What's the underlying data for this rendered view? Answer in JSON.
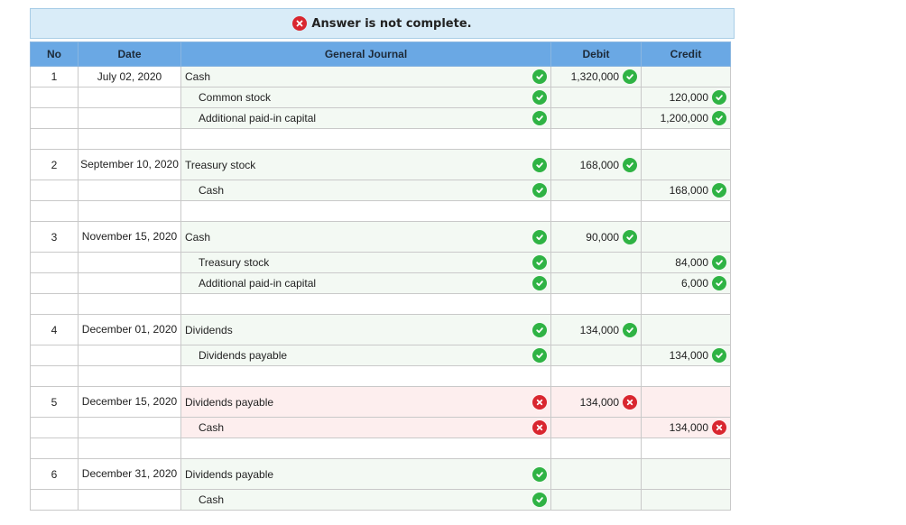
{
  "banner": {
    "status_icon": "cross-circle-icon",
    "text": "Answer is not complete."
  },
  "headers": {
    "no": "No",
    "date": "Date",
    "journal": "General Journal",
    "debit": "Debit",
    "credit": "Credit"
  },
  "colors": {
    "header_bg": "#6aa8e4",
    "correct": "#2fb344",
    "incorrect": "#d9262f",
    "banner_bg": "#d9ecf8"
  },
  "rows": [
    {
      "no": "1",
      "date": "July 02, 2020",
      "account": "Cash",
      "indent": false,
      "acct_status": "correct",
      "debit": "1,320,000",
      "debit_status": "correct",
      "credit": "",
      "credit_status": ""
    },
    {
      "no": "",
      "date": "",
      "account": "Common stock",
      "indent": true,
      "acct_status": "correct",
      "debit": "",
      "debit_status": "",
      "credit": "120,000",
      "credit_status": "correct"
    },
    {
      "no": "",
      "date": "",
      "account": "Additional paid-in capital",
      "indent": true,
      "acct_status": "correct",
      "debit": "",
      "debit_status": "",
      "credit": "1,200,000",
      "credit_status": "correct"
    },
    {
      "no": "",
      "date": "",
      "account": "",
      "indent": false,
      "acct_status": "",
      "debit": "",
      "debit_status": "",
      "credit": "",
      "credit_status": "",
      "blank": true
    },
    {
      "no": "2",
      "date": "September 10, 2020",
      "account": "Treasury stock",
      "indent": false,
      "acct_status": "correct",
      "debit": "168,000",
      "debit_status": "correct",
      "credit": "",
      "credit_status": "",
      "tall": true
    },
    {
      "no": "",
      "date": "",
      "account": "Cash",
      "indent": true,
      "acct_status": "correct",
      "debit": "",
      "debit_status": "",
      "credit": "168,000",
      "credit_status": "correct"
    },
    {
      "no": "",
      "date": "",
      "account": "",
      "indent": false,
      "acct_status": "",
      "debit": "",
      "debit_status": "",
      "credit": "",
      "credit_status": "",
      "blank": true
    },
    {
      "no": "3",
      "date": "November 15, 2020",
      "account": "Cash",
      "indent": false,
      "acct_status": "correct",
      "debit": "90,000",
      "debit_status": "correct",
      "credit": "",
      "credit_status": "",
      "tall": true
    },
    {
      "no": "",
      "date": "",
      "account": "Treasury stock",
      "indent": true,
      "acct_status": "correct",
      "debit": "",
      "debit_status": "",
      "credit": "84,000",
      "credit_status": "correct"
    },
    {
      "no": "",
      "date": "",
      "account": "Additional paid-in capital",
      "indent": true,
      "acct_status": "correct",
      "debit": "",
      "debit_status": "",
      "credit": "6,000",
      "credit_status": "correct"
    },
    {
      "no": "",
      "date": "",
      "account": "",
      "indent": false,
      "acct_status": "",
      "debit": "",
      "debit_status": "",
      "credit": "",
      "credit_status": "",
      "blank": true
    },
    {
      "no": "4",
      "date": "December 01, 2020",
      "account": "Dividends",
      "indent": false,
      "acct_status": "correct",
      "debit": "134,000",
      "debit_status": "correct",
      "credit": "",
      "credit_status": "",
      "tall": true
    },
    {
      "no": "",
      "date": "",
      "account": "Dividends payable",
      "indent": true,
      "acct_status": "correct",
      "debit": "",
      "debit_status": "",
      "credit": "134,000",
      "credit_status": "correct"
    },
    {
      "no": "",
      "date": "",
      "account": "",
      "indent": false,
      "acct_status": "",
      "debit": "",
      "debit_status": "",
      "credit": "",
      "credit_status": "",
      "blank": true
    },
    {
      "no": "5",
      "date": "December 15, 2020",
      "account": "Dividends payable",
      "indent": false,
      "acct_status": "incorrect",
      "debit": "134,000",
      "debit_status": "incorrect",
      "credit": "",
      "credit_status": "",
      "tall": true
    },
    {
      "no": "",
      "date": "",
      "account": "Cash",
      "indent": true,
      "acct_status": "incorrect",
      "debit": "",
      "debit_status": "",
      "credit": "134,000",
      "credit_status": "incorrect"
    },
    {
      "no": "",
      "date": "",
      "account": "",
      "indent": false,
      "acct_status": "",
      "debit": "",
      "debit_status": "",
      "credit": "",
      "credit_status": "",
      "blank": true
    },
    {
      "no": "6",
      "date": "December 31, 2020",
      "account": "Dividends payable",
      "indent": false,
      "acct_status": "correct",
      "debit": "",
      "debit_status": "",
      "credit": "",
      "credit_status": "",
      "tall": true
    },
    {
      "no": "",
      "date": "",
      "account": "Cash",
      "indent": true,
      "acct_status": "correct",
      "debit": "",
      "debit_status": "",
      "credit": "",
      "credit_status": ""
    }
  ]
}
